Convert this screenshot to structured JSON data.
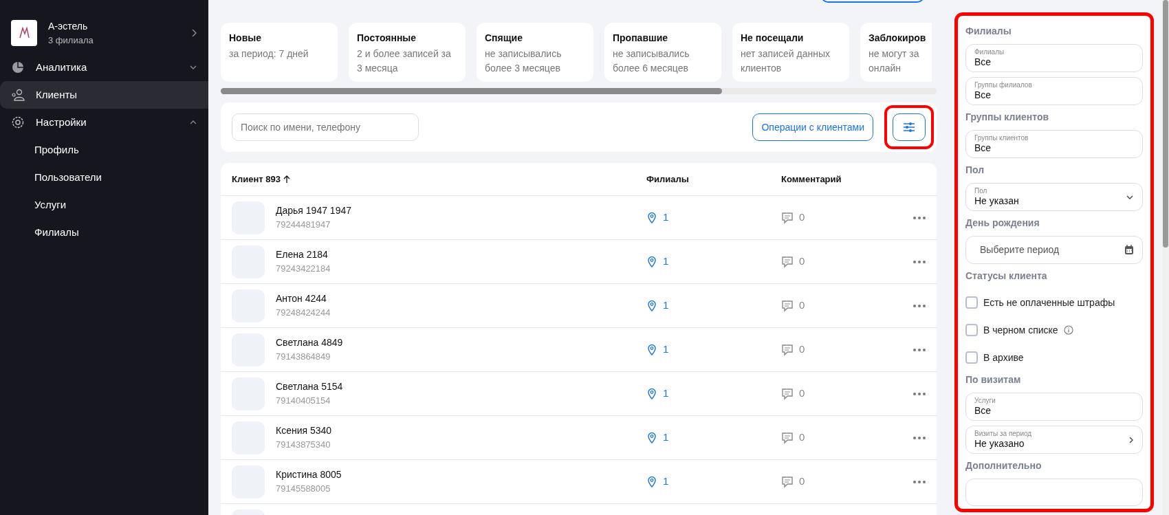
{
  "sidebar": {
    "org": {
      "name": "А-эстель",
      "subtitle": "3 филиала"
    },
    "items": [
      {
        "label": "Аналитика",
        "selected": false,
        "expanded": false
      },
      {
        "label": "Клиенты",
        "selected": true
      },
      {
        "label": "Настройки",
        "selected": false,
        "expanded": true,
        "children": [
          {
            "label": "Профиль",
            "selected": false
          },
          {
            "label": "Пользователи",
            "selected": false
          },
          {
            "label": "Услуги",
            "selected": false
          },
          {
            "label": "Филиалы",
            "selected": false
          }
        ]
      }
    ]
  },
  "segments": [
    {
      "title": "Новые",
      "subtitle": "за период: 7 дней"
    },
    {
      "title": "Постоянные",
      "subtitle": "2 и более записей за 3 месяца"
    },
    {
      "title": "Спящие",
      "subtitle": "не записывались более 3 месяцев"
    },
    {
      "title": "Пропавшие",
      "subtitle": "не записывались более 6 месяцев"
    },
    {
      "title": "Не посещали",
      "subtitle": "нет записей данных клиентов"
    },
    {
      "title": "Заблокиров",
      "subtitle": "не могут за онлайн"
    }
  ],
  "toolbar": {
    "search": {
      "placeholder": "Поиск по имени, телефону"
    },
    "operations_button": "Операции с клиентами",
    "filter_button": {
      "highlighted": true
    }
  },
  "table": {
    "columns": [
      {
        "label": "Клиент 893",
        "sorted": true
      },
      {
        "label": "Филиалы"
      },
      {
        "label": "Комментарий"
      }
    ],
    "rows": [
      {
        "name": "Дарья 1947 1947",
        "phone": "79244481947",
        "branches": "1",
        "comments": "0"
      },
      {
        "name": "Елена 2184",
        "phone": "79243422184",
        "branches": "1",
        "comments": "0"
      },
      {
        "name": "Антон 4244",
        "phone": "79248424244",
        "branches": "1",
        "comments": "0"
      },
      {
        "name": "Светлана 4849",
        "phone": "79143864849",
        "branches": "1",
        "comments": "0"
      },
      {
        "name": "Светлана 5154",
        "phone": "79140405154",
        "branches": "1",
        "comments": "0"
      },
      {
        "name": "Ксения 5340",
        "phone": "79143875340",
        "branches": "1",
        "comments": "0"
      },
      {
        "name": "Кристина 8005",
        "phone": "79145588005",
        "branches": "1",
        "comments": "0"
      }
    ]
  },
  "filters": {
    "highlighted": true,
    "sections": [
      {
        "heading": "Филиалы",
        "controls": [
          {
            "kind": "select",
            "label": "Филиалы",
            "value": "Все"
          },
          {
            "kind": "select",
            "label": "Группы филиалов",
            "value": "Все"
          }
        ]
      },
      {
        "heading": "Группы клиентов",
        "controls": [
          {
            "kind": "select",
            "label": "Группы клиентов",
            "value": "Все"
          }
        ]
      },
      {
        "heading": "Пол",
        "controls": [
          {
            "kind": "dropdown",
            "label": "Пол",
            "value": "Не указан"
          }
        ]
      },
      {
        "heading": "День рождения",
        "controls": [
          {
            "kind": "date",
            "placeholder": "Выберите период"
          }
        ]
      },
      {
        "heading": "Статусы клиента",
        "controls": [
          {
            "kind": "checkbox",
            "label": "Есть не оплаченные штрафы",
            "checked": false,
            "info": false
          },
          {
            "kind": "checkbox",
            "label": "В черном списке",
            "checked": false,
            "info": true
          },
          {
            "kind": "checkbox",
            "label": "В архиве",
            "checked": false,
            "info": false
          }
        ]
      },
      {
        "heading": "По визитам",
        "controls": [
          {
            "kind": "select",
            "label": "Услуги",
            "value": "Все"
          },
          {
            "kind": "link",
            "label": "Визиты за период",
            "value": "Не указано"
          }
        ]
      },
      {
        "heading": "Дополнительно",
        "controls": [
          {
            "kind": "stub"
          }
        ]
      }
    ]
  }
}
